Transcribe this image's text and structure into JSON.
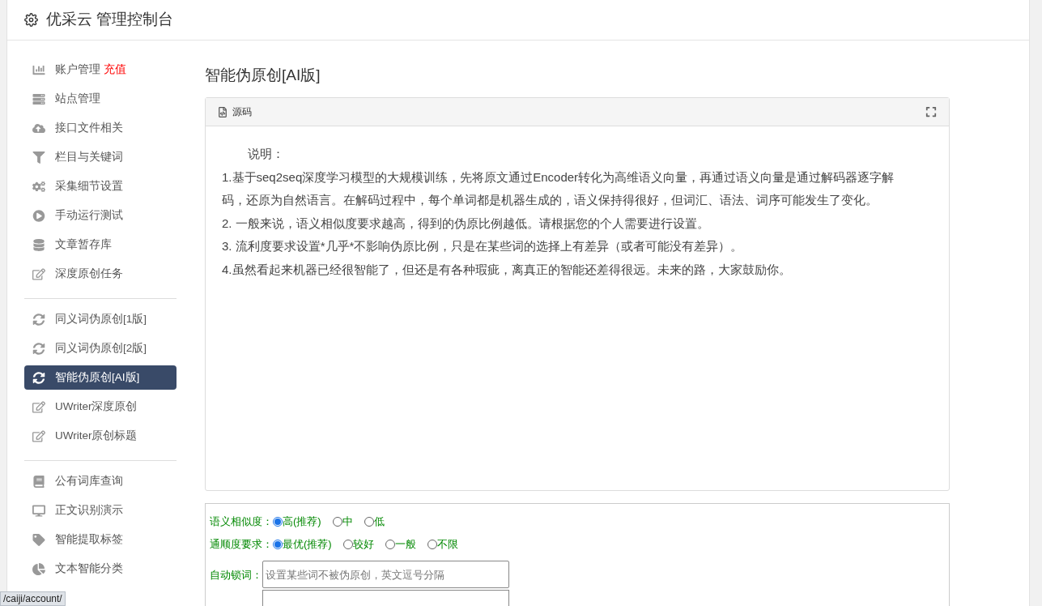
{
  "header": {
    "title": "优采云 管理控制台"
  },
  "sidebar": {
    "groups": [
      {
        "items": [
          {
            "label": "账户管理",
            "badge": "充值",
            "selected": false
          },
          {
            "label": "站点管理",
            "selected": false
          },
          {
            "label": "接口文件相关",
            "selected": false
          },
          {
            "label": "栏目与关键词",
            "selected": false
          },
          {
            "label": "采集细节设置",
            "selected": false
          },
          {
            "label": "手动运行测试",
            "selected": false
          },
          {
            "label": "文章暂存库",
            "selected": false
          },
          {
            "label": "深度原创任务",
            "selected": false
          }
        ]
      },
      {
        "items": [
          {
            "label": "同义词伪原创[1版]",
            "selected": false
          },
          {
            "label": "同义词伪原创[2版]",
            "selected": false
          },
          {
            "label": "智能伪原创[AI版]",
            "selected": true
          },
          {
            "label": "UWriter深度原创",
            "selected": false
          },
          {
            "label": "UWriter原创标题",
            "selected": false
          }
        ]
      },
      {
        "items": [
          {
            "label": "公有词库查询",
            "selected": false
          },
          {
            "label": "正文识别演示",
            "selected": false
          },
          {
            "label": "智能提取标签",
            "selected": false
          },
          {
            "label": "文本智能分类",
            "selected": false
          }
        ]
      }
    ]
  },
  "page_title": "智能伪原创[AI版]",
  "editor": {
    "toolbar_label": "源码",
    "paragraphs": [
      "说明：",
      "1.基于seq2seq深度学习模型的大规模训练，先将原文通过Encoder转化为高维语义向量，再通过语义向量是通过解码器逐字解码，还原为自然语言。在解码过程中，每个单词都是机器生成的，语义保持得很好，但词汇、语法、词序可能发生了变化。",
      "2. 一般来说，语义相似度要求越高，得到的伪原比例越低。请根据您的个人需要进行设置。",
      "3. 流利度要求设置*几乎*不影响伪原比例，只是在某些词的选择上有差异（或者可能没有差异）。",
      "4.虽然看起来机器已经很智能了，但还是有各种瑕疵，离真正的智能还差得很远。未来的路，大家鼓励你。"
    ]
  },
  "options": [
    {
      "label": "语义相似度：",
      "choices": [
        {
          "label": "高(推荐)",
          "selected": true
        },
        {
          "label": "中",
          "selected": false
        },
        {
          "label": "低",
          "selected": false
        }
      ]
    },
    {
      "label": "通顺度要求：",
      "choices": [
        {
          "label": "最优(推荐)",
          "selected": true
        },
        {
          "label": "较好",
          "selected": false
        },
        {
          "label": "一般",
          "selected": false
        },
        {
          "label": "不限",
          "selected": false
        }
      ]
    }
  ],
  "lock_words": {
    "label": "自动锁词：",
    "placeholder": "设置某些词不被伪原创，英文逗号分隔"
  },
  "status_url": "/caiji/account/"
}
